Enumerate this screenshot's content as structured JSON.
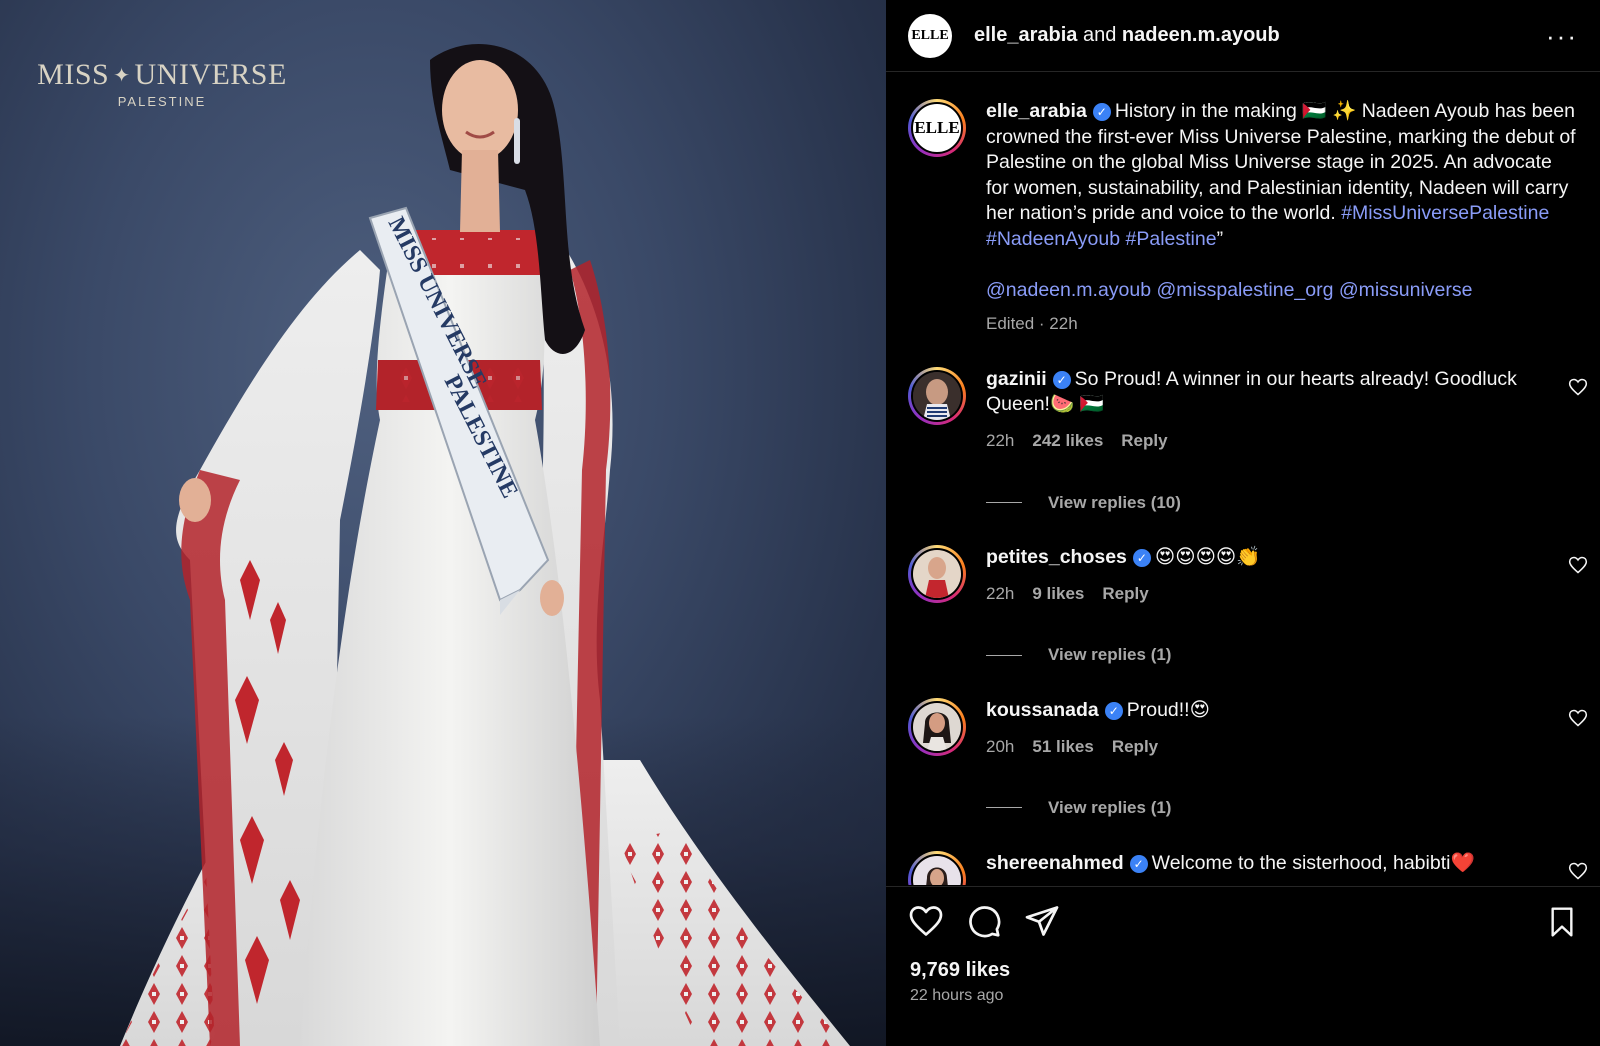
{
  "photo": {
    "brand_main_left": "MISS",
    "brand_main_right": "UNIVERSE",
    "brand_sub": "PALESTINE",
    "sash_line1": "MISS UNIVERSE",
    "sash_line2": "PALESTINE"
  },
  "header": {
    "avatar_text": "ELLE",
    "user1": "elle_arabia",
    "joiner": " and ",
    "user2": "nadeen.m.ayoub",
    "more_label": "···"
  },
  "caption": {
    "avatar_text": "ELLE",
    "username": "elle_arabia",
    "text": "History in the making 🇵🇸 ✨ Nadeen Ayoub has been crowned the first-ever Miss Universe Palestine, marking the debut of Palestine on the global Miss Universe stage in 2025. An advocate for women, sustainability, and Palestinian identity, Nadeen will carry her nation’s pride and voice to the world. ",
    "hashtags": [
      "#MissUniversePalestine",
      "#NadeenAyoub",
      "#Palestine"
    ],
    "closing_quote": "”",
    "mentions": [
      "@nadeen.m.ayoub",
      "@misspalestine_org",
      "@missuniverse"
    ],
    "meta": "Edited · 22h"
  },
  "comments": [
    {
      "username": "gazinii",
      "text": "So Proud! A winner in our hearts already! Goodluck Queen!🍉 🇵🇸",
      "time": "22h",
      "likes": "242 likes",
      "reply": "Reply",
      "view_replies": "View replies (10)"
    },
    {
      "username": "petites_choses",
      "text": "😍😍😍😍👏",
      "time": "22h",
      "likes": "9 likes",
      "reply": "Reply",
      "view_replies": "View replies (1)"
    },
    {
      "username": "koussanada",
      "text": "Proud!!😍",
      "time": "20h",
      "likes": "51 likes",
      "reply": "Reply",
      "view_replies": "View replies (1)"
    },
    {
      "username": "shereenahmed",
      "text": "Welcome to the sisterhood, habibti❤️",
      "time": "",
      "likes": "",
      "reply": "",
      "view_replies": ""
    }
  ],
  "footer": {
    "likes": "9,769 likes",
    "time_ago": "22 hours ago"
  },
  "colors": {
    "link": "#8a9cf8",
    "verified": "#3b82f6",
    "muted": "#a8a8a8",
    "background": "#000000"
  },
  "icons": [
    "heart-icon",
    "comment-icon",
    "share-icon",
    "bookmark-icon",
    "more-icon",
    "verified-icon"
  ]
}
